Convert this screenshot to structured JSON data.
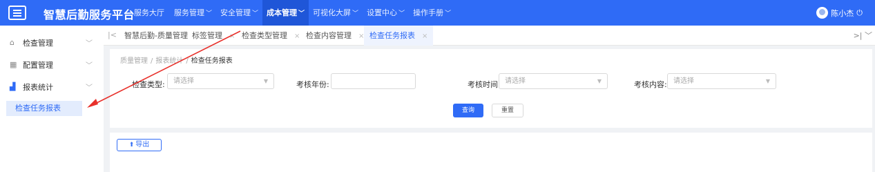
{
  "app": {
    "title": "智慧后勤服务平台"
  },
  "nav": [
    {
      "label": "服务大厅",
      "caret": ""
    },
    {
      "label": "服务管理",
      "caret": "﹀"
    },
    {
      "label": "安全管理",
      "caret": "﹀"
    },
    {
      "label": "成本管理",
      "caret": "﹀"
    },
    {
      "label": "可视化大屏",
      "caret": "﹀"
    },
    {
      "label": "设置中心",
      "caret": "﹀"
    },
    {
      "label": "操作手册",
      "caret": "﹀"
    }
  ],
  "user": {
    "name": "陈小杰",
    "power_icon": "⏻"
  },
  "sidebar": {
    "items": [
      {
        "icon": "home-icon",
        "glyph": "⌂",
        "label": "检查管理",
        "chevron": "﹀"
      },
      {
        "icon": "grid-icon",
        "glyph": "▦",
        "label": "配置管理",
        "chevron": "﹀"
      },
      {
        "icon": "bar-chart-icon",
        "glyph": "▟",
        "label": "报表统计",
        "chevron": "﹀"
      }
    ],
    "active_sub": "检查任务报表"
  },
  "tabs": {
    "left_arrow": "|<",
    "right_arrow": ">|  ﹀",
    "items": [
      {
        "label": "智慧后勤-质量管理",
        "close": ""
      },
      {
        "label": "标签管理",
        "close": "×"
      },
      {
        "label": "检查类型管理",
        "close": "×"
      },
      {
        "label": "检查内容管理",
        "close": "×"
      },
      {
        "label": "检查任务报表",
        "close": "×"
      }
    ]
  },
  "breadcrumb": {
    "l1": "质量管理",
    "l2": "报表统计",
    "l3": "检查任务报表",
    "sep": "/"
  },
  "filters": {
    "type_label": "检查类型:",
    "type_placeholder": "请选择",
    "year_label": "考核年份:",
    "year_value": "",
    "time_label": "考核时间",
    "time_placeholder": "请选择",
    "content_label": "考核内容:",
    "content_placeholder": "请选择",
    "dropdown_glyph": "▼"
  },
  "actions": {
    "query": "查询",
    "reset": "重置",
    "export": "导出",
    "export_glyph": "⬆"
  },
  "colors": {
    "primary": "#2f6bf6",
    "annotation": "#e8302a"
  }
}
